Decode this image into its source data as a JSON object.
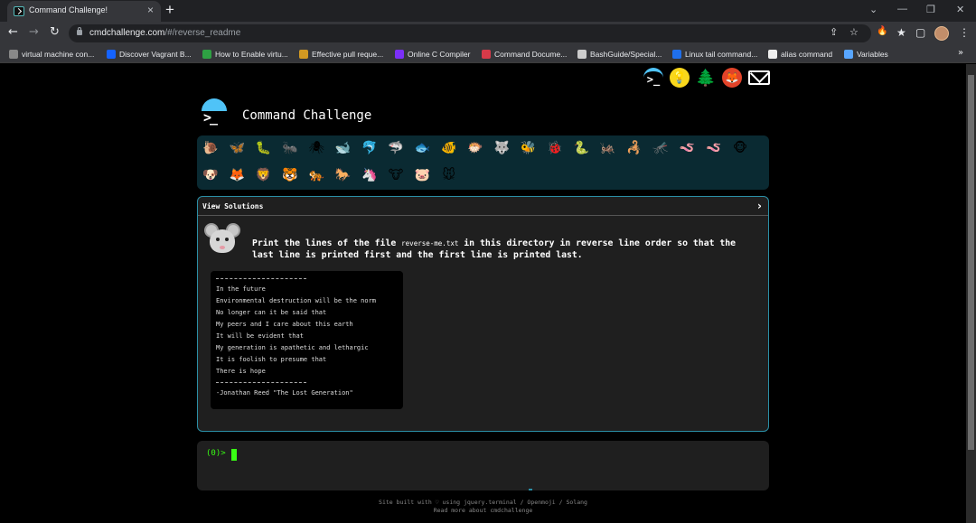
{
  "browser": {
    "tab_title": "Command Challenge!",
    "tab_close": "×",
    "new_tab": "+",
    "url_host": "cmdchallenge.com",
    "url_path": "/#/reverse_readme",
    "controls": {
      "minimize": "⌄",
      "minus": "—",
      "restore": "❐",
      "close": "✕"
    },
    "nav": {
      "back": "←",
      "forward": "→",
      "reload": "↻"
    },
    "omnibox_icons": {
      "share": "⇪",
      "star": "☆"
    },
    "extensions": [
      "🔥",
      "★",
      "▢"
    ],
    "menu": "⋮"
  },
  "bookmarks": [
    {
      "label": "virtual machine con...",
      "color": "#888888"
    },
    {
      "label": "Discover Vagrant B...",
      "color": "#1563ff"
    },
    {
      "label": "How to Enable virtu...",
      "color": "#2ea043"
    },
    {
      "label": "Effective pull reque...",
      "color": "#d29922"
    },
    {
      "label": "Online C Compiler",
      "color": "#7b2ff7"
    },
    {
      "label": "Command Docume...",
      "color": "#d73a49"
    },
    {
      "label": "BashGuide/Special...",
      "color": "#cccccc"
    },
    {
      "label": "Linux tail command...",
      "color": "#1f6feb"
    },
    {
      "label": "alias command",
      "color": "#eeeeee"
    },
    {
      "label": "Variables",
      "color": "#58a6ff"
    }
  ],
  "bookmarks_more": "»",
  "header": {
    "title": "Command Challenge",
    "logo_prompt": ">_",
    "top_icons": {
      "terminal": ">_",
      "bulb": "💡",
      "tree": "🌲",
      "gitlab": "🦊",
      "mail": ""
    }
  },
  "animals": [
    "🐌",
    "🦋",
    "🐛",
    "🐜",
    "🕷",
    "🐋",
    "🐬",
    "🦈",
    "🐟",
    "🐠",
    "🐡",
    "🐺",
    "🐝",
    "🐞",
    "🐍",
    "🦗",
    "🦂",
    "🦟",
    "🪱",
    "🪱",
    "🐵",
    "🐶",
    "🦊",
    "🦁",
    "🐯",
    "🐅",
    "🐎",
    "🦄",
    "🐮",
    "🐷",
    "🐭"
  ],
  "challenge": {
    "view_solutions": "View Solutions",
    "chevron": "›",
    "prompt_pre": "Print the lines of the file ",
    "filename": "reverse-me.txt",
    "prompt_post": " in this directory in reverse line order so that the last line is printed first and the first line is printed last.",
    "file_lines": [
      "In the future",
      "Environmental destruction will be the norm",
      "No longer can it be said that",
      "My peers and I care about this earth",
      "It will be evident that",
      "My generation is apathetic and lethargic",
      "It is foolish to presume that",
      "There is hope"
    ],
    "attribution": "-Jonathan Reed \"The Lost Generation\""
  },
  "terminal": {
    "prompt": "(0)>"
  },
  "footer": {
    "line1": "Site built with ♡ using jquery.terminal / Openmoji / Solang",
    "line2": "Read more about cmdchallenge"
  }
}
